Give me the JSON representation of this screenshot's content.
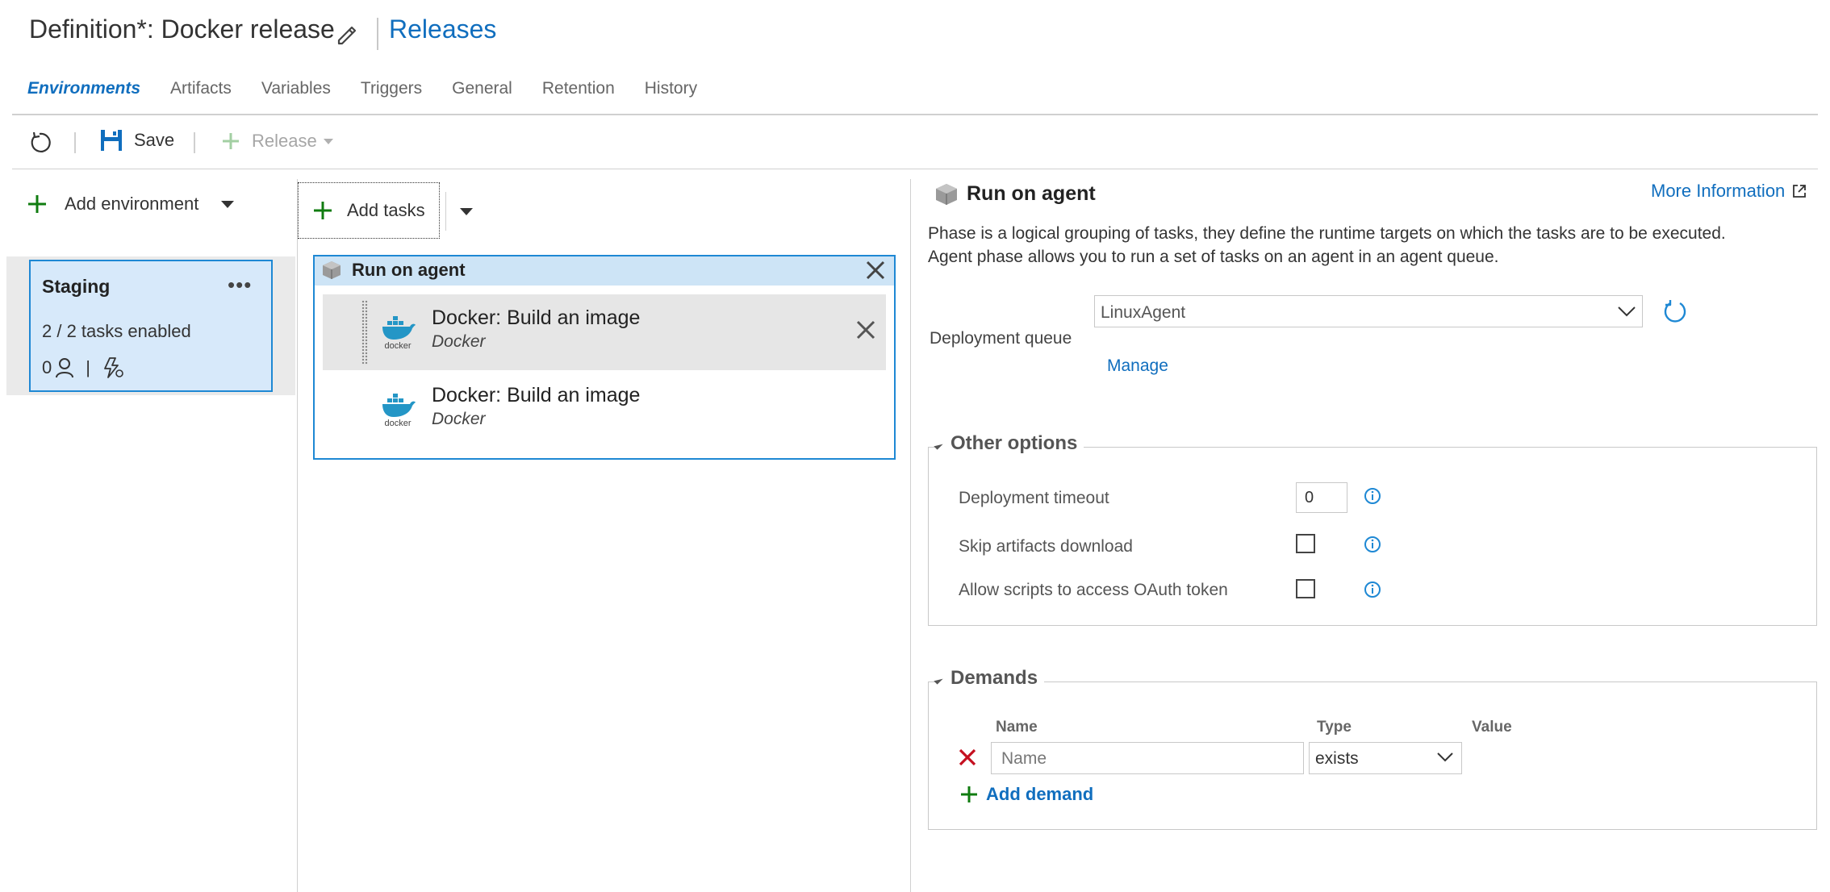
{
  "header": {
    "title": "Definition*: Docker release",
    "releases_link": "Releases"
  },
  "tabs": [
    {
      "label": "Environments",
      "active": true
    },
    {
      "label": "Artifacts"
    },
    {
      "label": "Variables"
    },
    {
      "label": "Triggers"
    },
    {
      "label": "General"
    },
    {
      "label": "Retention"
    },
    {
      "label": "History"
    }
  ],
  "toolbar": {
    "save_label": "Save",
    "release_label": "Release"
  },
  "environments": {
    "add_label": "Add environment",
    "items": [
      {
        "name": "Staging",
        "more": "•••",
        "tasks_status": "2 / 2 tasks enabled",
        "approvers_count": "0"
      }
    ]
  },
  "tasks_panel": {
    "add_label": "Add tasks",
    "phase_title": "Run on agent",
    "tasks": [
      {
        "name": "Docker: Build an image",
        "type": "Docker",
        "logo_text": "docker"
      },
      {
        "name": "Docker: Build an image",
        "type": "Docker",
        "logo_text": "docker"
      }
    ]
  },
  "details": {
    "title": "Run on agent",
    "more_info": "More Information",
    "description_line1": "Phase is a logical grouping of tasks, they define the runtime targets on which the tasks are to be executed.",
    "description_line2": "Agent phase allows you to run a set of tasks on an agent in an agent queue.",
    "deployment_queue_label": "Deployment queue",
    "deployment_queue_value": "LinuxAgent",
    "manage_label": "Manage",
    "other_options": {
      "title": "Other options",
      "timeout_label": "Deployment timeout",
      "timeout_value": "0",
      "skip_artifacts_label": "Skip artifacts download",
      "oauth_label": "Allow scripts to access OAuth token"
    },
    "demands": {
      "title": "Demands",
      "col_name": "Name",
      "col_type": "Type",
      "col_value": "Value",
      "name_placeholder": "Name",
      "type_value": "exists",
      "add_label": "Add demand"
    }
  },
  "colors": {
    "accent": "#106ebe",
    "selection_border": "#1e88d4",
    "selection_fill": "#d7e9fa",
    "add_green": "#107c10",
    "remove_red": "#c50f1f",
    "docker_blue": "#2496c6"
  },
  "icons": [
    "edit-icon",
    "refresh-icon",
    "save-icon",
    "plus-icon",
    "caret-down-icon",
    "more-icon",
    "person-icon",
    "lightning-icon",
    "box-icon",
    "close-icon",
    "docker-icon",
    "external-link-icon",
    "chevron-down-icon",
    "info-icon",
    "remove-icon"
  ]
}
